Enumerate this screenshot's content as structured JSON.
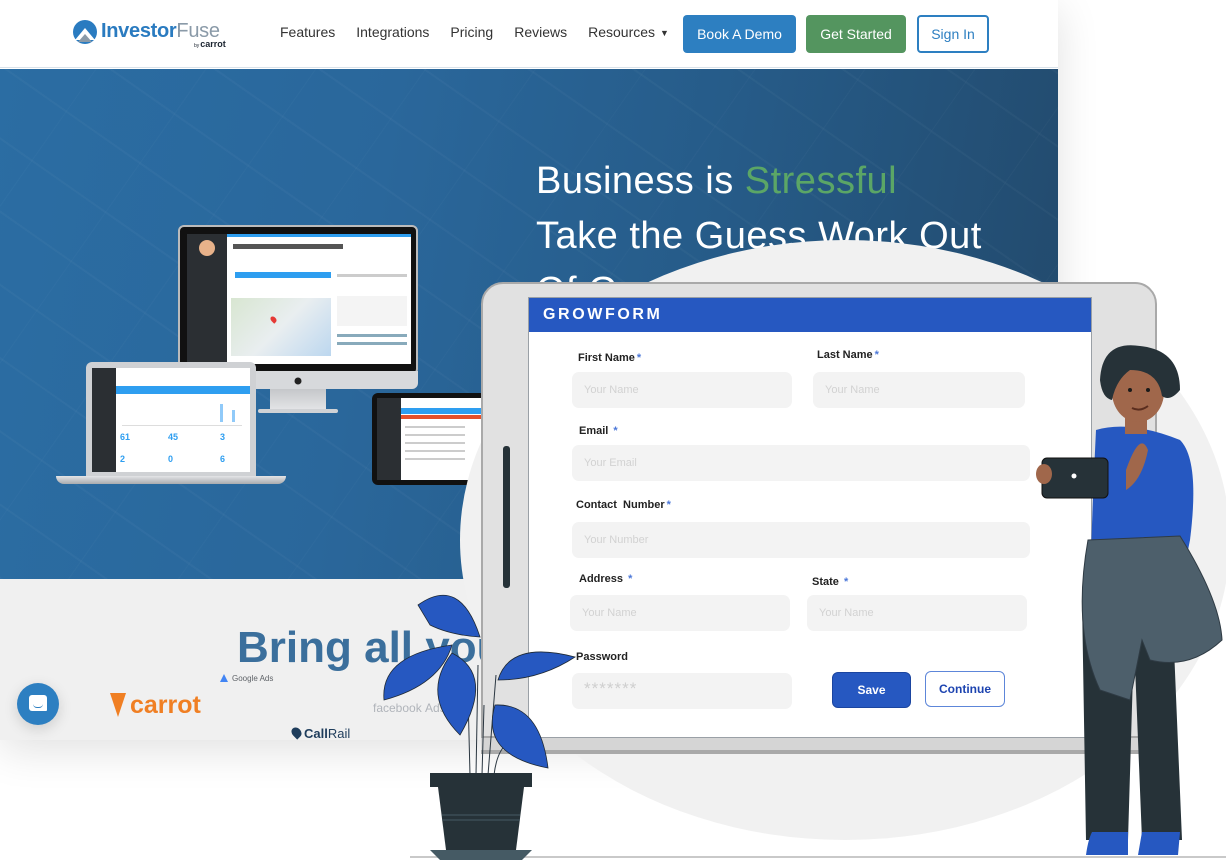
{
  "nav": {
    "logo": {
      "brand_primary": "Investor",
      "brand_secondary": "Fuse",
      "by_prefix": "by",
      "by_brand": "carrot"
    },
    "links": [
      {
        "label": "Features"
      },
      {
        "label": "Integrations"
      },
      {
        "label": "Pricing"
      },
      {
        "label": "Reviews"
      },
      {
        "label": "Resources",
        "caret": "▼"
      }
    ],
    "buttons": {
      "demo": "Book A Demo",
      "get_started": "Get Started",
      "sign_in": "Sign In"
    },
    "colors": {
      "primary_blue": "#2d7fc1",
      "green": "#54955f"
    }
  },
  "hero": {
    "line1_prefix": "Business is ",
    "line1_accent": "Stressful",
    "line2": "Take the Guess Work Out",
    "line3_partial": "Of Generating Leads",
    "accent_color": "#5ba666",
    "devices": {
      "laptop_values": [
        "61",
        "45",
        "3",
        "2",
        "0",
        "6"
      ]
    }
  },
  "integrations": {
    "title_partial": "Bring all your",
    "brands": {
      "google": "Google Ads",
      "carrot": "carrot",
      "facebook": "facebook",
      "facebook_suffix": "Ads",
      "callrail_bold": "Call",
      "callrail_light": "Rail"
    }
  },
  "chat": {
    "icon": "chat-bubble-icon"
  },
  "growform": {
    "title": "GROWFORM",
    "header_color": "#2658c1",
    "required_mark": "*",
    "fields": {
      "first_name": {
        "label": "First Name",
        "placeholder": "Your Name",
        "value": ""
      },
      "last_name": {
        "label": "Last Name",
        "placeholder": "Your Name",
        "value": ""
      },
      "email": {
        "label": "Email",
        "placeholder": "Your Email",
        "value": ""
      },
      "contact": {
        "label": "Contact  Number",
        "placeholder": "Your Number",
        "value": ""
      },
      "address": {
        "label": "Address",
        "placeholder": "Your Name",
        "value": ""
      },
      "state": {
        "label": "State",
        "placeholder": "Your Name",
        "value": ""
      },
      "password": {
        "label": "Password",
        "placeholder": "*******",
        "value": ""
      }
    },
    "buttons": {
      "save": "Save",
      "continue": "Continue"
    }
  }
}
